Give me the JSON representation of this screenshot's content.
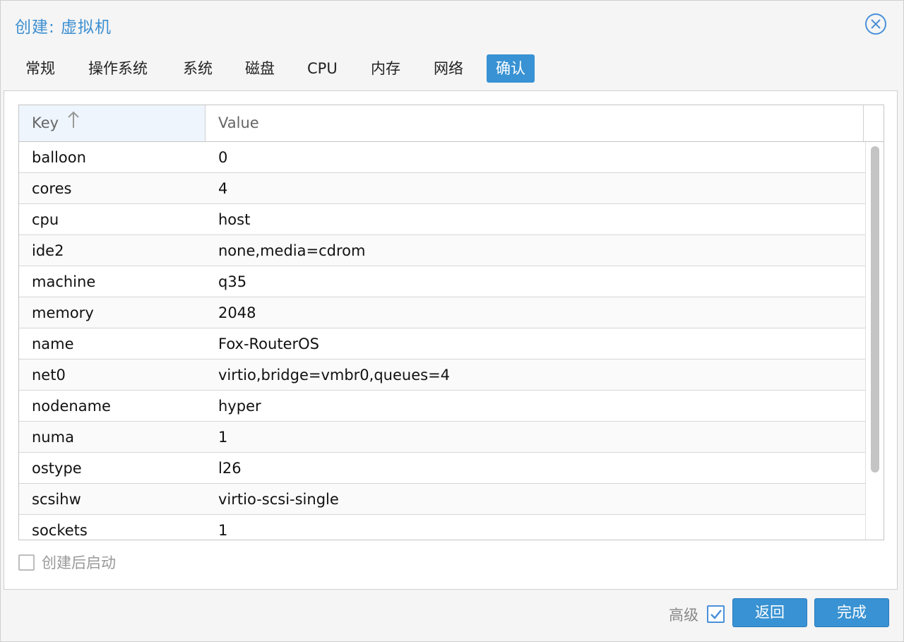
{
  "dialog": {
    "title": "创建: 虚拟机"
  },
  "tabs": [
    {
      "label": "常规"
    },
    {
      "label": "操作系统"
    },
    {
      "label": "系统"
    },
    {
      "label": "磁盘"
    },
    {
      "label": "CPU"
    },
    {
      "label": "内存"
    },
    {
      "label": "网络"
    },
    {
      "label": "确认",
      "active": true
    }
  ],
  "grid": {
    "columns": {
      "key": "Key",
      "value": "Value"
    },
    "sort": {
      "column": "Key",
      "direction": "ascending"
    },
    "rows": [
      {
        "key": "balloon",
        "value": "0"
      },
      {
        "key": "cores",
        "value": "4"
      },
      {
        "key": "cpu",
        "value": "host"
      },
      {
        "key": "ide2",
        "value": "none,media=cdrom"
      },
      {
        "key": "machine",
        "value": "q35"
      },
      {
        "key": "memory",
        "value": "2048"
      },
      {
        "key": "name",
        "value": "Fox-RouterOS"
      },
      {
        "key": "net0",
        "value": "virtio,bridge=vmbr0,queues=4"
      },
      {
        "key": "nodename",
        "value": "hyper"
      },
      {
        "key": "numa",
        "value": "1"
      },
      {
        "key": "ostype",
        "value": "l26"
      },
      {
        "key": "scsihw",
        "value": "virtio-scsi-single"
      },
      {
        "key": "sockets",
        "value": "1"
      }
    ]
  },
  "start_after_create": {
    "label": "创建后启动",
    "checked": false
  },
  "footer": {
    "advanced_label": "高级",
    "advanced_checked": true,
    "back_label": "返回",
    "finish_label": "完成"
  },
  "colors": {
    "accent": "#3892d3",
    "title": "#3d8fd1"
  }
}
